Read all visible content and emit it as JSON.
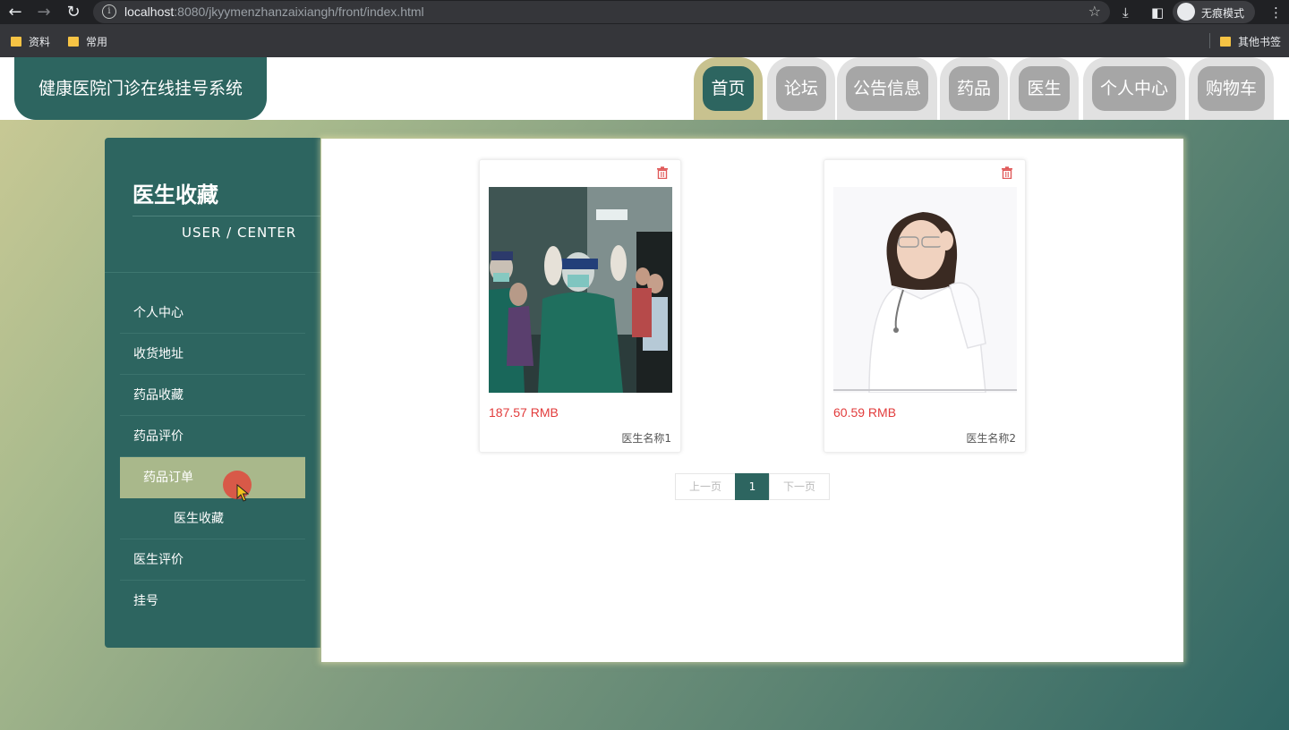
{
  "browser": {
    "url_host": "localhost",
    "url_rest": ":8080/jkyymenzhanzaixiangh/front/index.html",
    "incognito_label": "无痕模式",
    "bookmarks": [
      "资料",
      "常用"
    ],
    "other_bookmarks": "其他书签"
  },
  "header": {
    "logo": "健康医院门诊在线挂号系统",
    "nav": [
      "首页",
      "论坛",
      "公告信息",
      "药品",
      "医生",
      "个人中心",
      "购物车"
    ],
    "active_nav": "首页"
  },
  "sidebar": {
    "title": "医生收藏",
    "subtitle": "USER / CENTER",
    "items": [
      "个人中心",
      "收货地址",
      "药品收藏",
      "药品评价",
      "药品订单",
      "医生收藏",
      "医生评价",
      "挂号"
    ],
    "active_item": "药品订单"
  },
  "cards": [
    {
      "price": "187.57 RMB",
      "name": "医生名称1",
      "image": "surgeons-in-operating-room"
    },
    {
      "price": "60.59 RMB",
      "name": "医生名称2",
      "image": "female-doctor-portrait"
    }
  ],
  "pager": {
    "prev": "上一页",
    "current": "1",
    "next": "下一页"
  },
  "colors": {
    "primary": "#2d6560",
    "accent": "#c8c28f",
    "price": "#e23c3c",
    "tab_inactive": "#a6a6a6"
  }
}
